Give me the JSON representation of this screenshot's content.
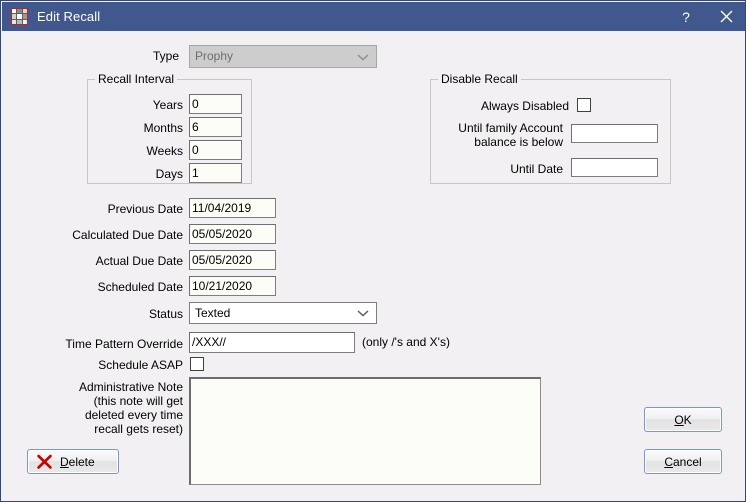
{
  "window": {
    "title": "Edit Recall",
    "icon": "app-grid-icon",
    "help_label": "?",
    "close_label": "✕",
    "accent_titlebar": "#41588f",
    "border_color": "#31487f",
    "surface": "#f2f0f2"
  },
  "form": {
    "type": {
      "label": "Type",
      "value": "Prophy",
      "disabled": true
    },
    "recall_interval": {
      "group_title": "Recall Interval",
      "fields": [
        {
          "label": "Years",
          "value": "0"
        },
        {
          "label": "Months",
          "value": "6"
        },
        {
          "label": "Weeks",
          "value": "0"
        },
        {
          "label": "Days",
          "value": "1"
        }
      ]
    },
    "disable_recall": {
      "group_title": "Disable Recall",
      "always_disabled": {
        "label": "Always Disabled",
        "checked": false
      },
      "balance_below": {
        "label": "Until family Account\nbalance is below",
        "value": ""
      },
      "until_date": {
        "label": "Until Date",
        "value": ""
      }
    },
    "dates": [
      {
        "label": "Previous Date",
        "value": "11/04/2019"
      },
      {
        "label": "Calculated Due Date",
        "value": "05/05/2020"
      },
      {
        "label": "Actual Due Date",
        "value": "05/05/2020"
      },
      {
        "label": "Scheduled Date",
        "value": "10/21/2020"
      }
    ],
    "status": {
      "label": "Status",
      "value": "Texted"
    },
    "time_pattern_override": {
      "label": "Time Pattern Override",
      "value": "/XXX//",
      "hint": "(only /'s and X's)"
    },
    "schedule_asap": {
      "label": "Schedule ASAP",
      "checked": false
    },
    "administrative_note": {
      "label": "Administrative Note\n(this note will get\ndeleted every time\nrecall gets reset)",
      "value": ""
    }
  },
  "buttons": {
    "delete": {
      "label_pre": "",
      "label_accel": "D",
      "label_post": "elete",
      "icon": "red-x-icon"
    },
    "ok": {
      "label_accel": "O",
      "label_post": "K"
    },
    "cancel": {
      "label_accel": "C",
      "label_post": "ancel"
    }
  }
}
